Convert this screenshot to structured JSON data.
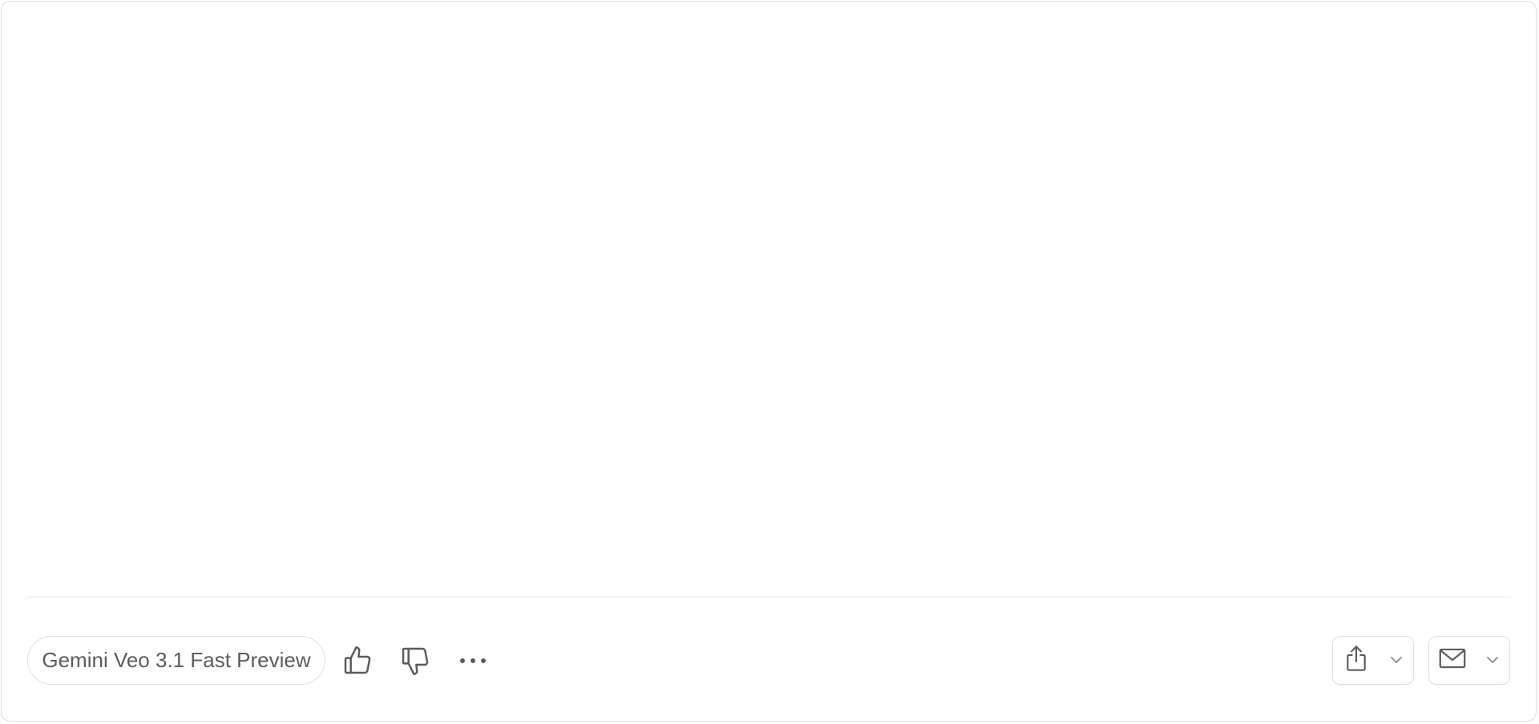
{
  "footer": {
    "model_label": "Gemini Veo 3.1 Fast Preview",
    "actions": {
      "thumbs_up_icon": "thumbs-up-icon",
      "thumbs_down_icon": "thumbs-down-icon",
      "more_icon": "more-horizontal-icon",
      "share_icon": "share-icon",
      "mail_icon": "mail-icon",
      "caret_icon": "chevron-down-icon"
    }
  },
  "colors": {
    "border": "#dcdcdc",
    "icon": "#5c5c5c",
    "text": "#5c5c5c",
    "caret": "#8a8a8a"
  }
}
